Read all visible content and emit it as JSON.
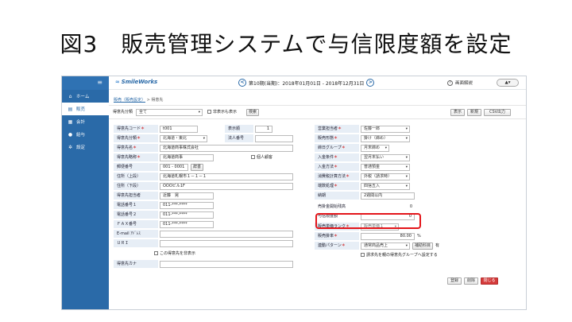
{
  "slide": {
    "title": "図3　販売管理システムで与信限度額を設定"
  },
  "sidebar": {
    "menu_icon": "hamburger-icon",
    "items": [
      {
        "label": "ホーム",
        "icon": "home-icon"
      },
      {
        "label": "販売",
        "icon": "cart-icon"
      },
      {
        "label": "会計",
        "icon": "ledger-icon"
      },
      {
        "label": "給与",
        "icon": "money-bag-icon"
      },
      {
        "label": "設定",
        "icon": "gear-icon"
      }
    ]
  },
  "header": {
    "logo": "SmileWorks",
    "period_text": "第10期(当期)：2018年01月01日 - 2018年12月31日",
    "prev": "<",
    "next": ">",
    "help_label": "画面解説",
    "user_glyph": "▲▾"
  },
  "breadcrumb": {
    "link": "販売（販売設定）",
    "sep": " > ",
    "current": "得意先"
  },
  "filter": {
    "category_label": "得意先分類",
    "category_value": "全て",
    "show_hidden_label": "非表示も表示",
    "search_button": "検索",
    "display_button": "表示",
    "new_button": "新規",
    "csv_button": "CSV出力"
  },
  "form_left": {
    "code_label": "得意先コード",
    "code_value": "t001",
    "display_order_label": "表示順",
    "display_order_value": "1",
    "category_label": "得意先分類",
    "category_value": "北海道・東北",
    "corp_no_label": "法人番号",
    "corp_no_value": "",
    "name_label": "得意先名",
    "name_value": "北海道商事株式会社",
    "short_label": "得意先略称",
    "short_value": "北海道商事",
    "individual_label": "個人顧客",
    "postal_label": "郵便番号",
    "postal_value": "001 - 0001",
    "postal_button": "辞書",
    "address1_label": "住所（上段）",
    "address1_value": "北海道札幌市１－１－１",
    "address2_label": "住所（下段）",
    "address2_value": "OOOビル1F",
    "contact_label": "得意先担当者",
    "contact_value": "近藤　晃",
    "phone1_label": "電話番号１",
    "phone1_value": "011-***-****",
    "phone2_label": "電話番号２",
    "phone2_value": "011-***-****",
    "fax_label": "ＦＡＸ番号",
    "fax_value": "011-***-****",
    "email_label": "E-mail ｱﾄﾞﾚｽ",
    "email_value": "",
    "url_label": "ＵＲＩ",
    "url_value": "",
    "hide_label": "この得意先を非表示",
    "kana_label": "得意先カナ",
    "kana_value": ""
  },
  "form_right": {
    "staff_label": "営業担当者",
    "staff_value": "佐藤一郎",
    "sales_type_label": "販売形態",
    "sales_type_value": "掛け（締め）",
    "closing_label": "締日グループ",
    "closing_value": "月末締め",
    "payment_label": "入金条件",
    "payment_value": "翌月末払い",
    "method_label": "入金方法",
    "method_value": "普通預金",
    "tax_label": "消費税計算方法",
    "tax_value": "外税（請求時）",
    "rounding_label": "端数処理",
    "rounding_value": "四捨五入",
    "terms_label": "納期",
    "terms_value": "2週間以内",
    "opening_balance_label": "売掛金開始残高",
    "opening_balance_value": "0",
    "credit_limit_label": "与信限度額",
    "credit_limit_value": "0",
    "price_rank_label": "販売単価ランク",
    "price_rank_value": "販売単価１",
    "rate_label": "販売掛率",
    "rate_value": "80.00",
    "rate_unit": "%",
    "link_pattern_label": "連動パターン",
    "link_pattern_value": "通常商品売上",
    "link_button": "補助科目",
    "link_suffix": "有",
    "billing_group_label": "請求先を親の得意先グループへ設定する"
  },
  "actions": {
    "register": "登録",
    "delete": "削除",
    "close": "閉じる"
  },
  "colors": {
    "sidebar": "#2a6aa8",
    "label_bg": "#e7eef6",
    "highlight": "#e3151a",
    "close_button": "#d43b3b"
  }
}
